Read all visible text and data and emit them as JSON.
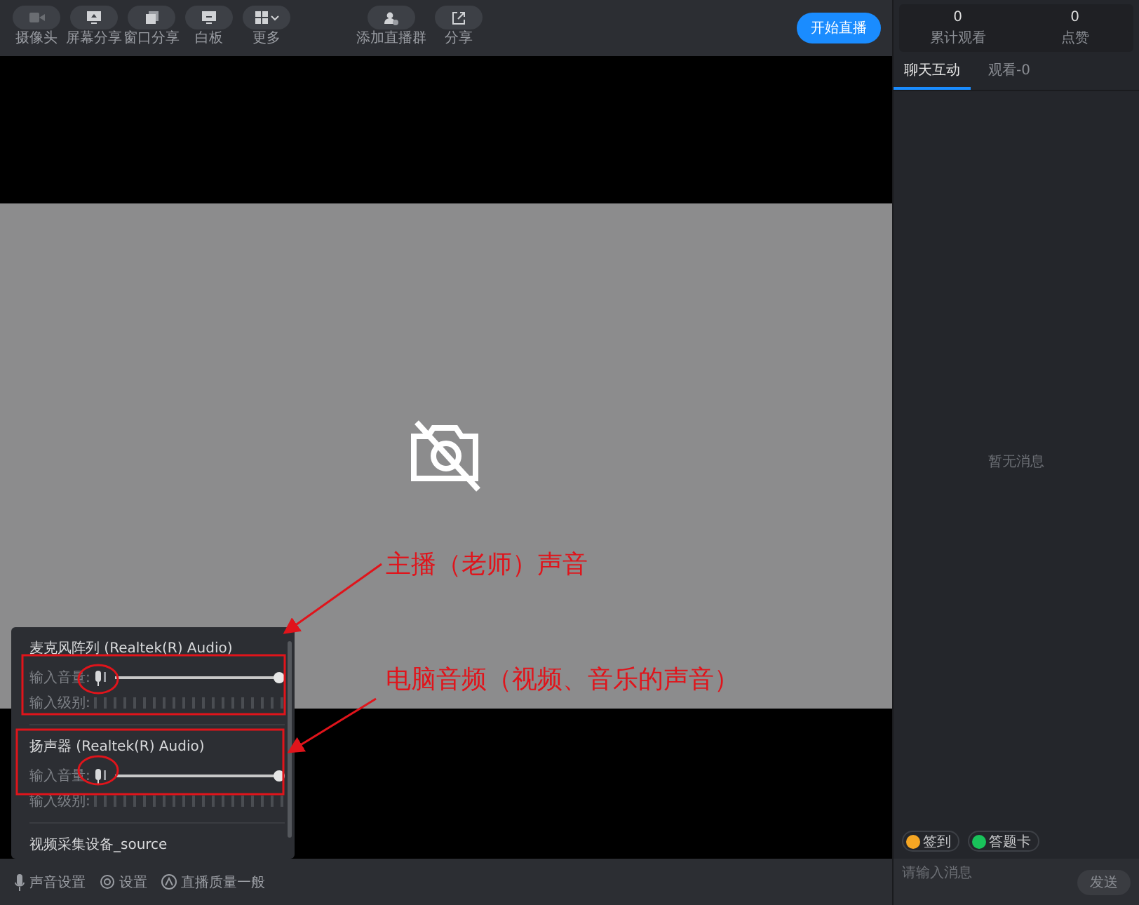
{
  "toolbar": {
    "tools": [
      {
        "kind": "camera",
        "label": "摄像头"
      },
      {
        "kind": "screen",
        "label": "屏幕分享"
      },
      {
        "kind": "window",
        "label": "窗口分享"
      },
      {
        "kind": "whiteboard",
        "label": "白板"
      },
      {
        "kind": "more",
        "label": "更多"
      }
    ],
    "group_tools": [
      {
        "kind": "group",
        "label": "添加直播群"
      },
      {
        "kind": "share",
        "label": "分享"
      }
    ],
    "start_button": "开始直播"
  },
  "audio_popup": {
    "devices": [
      {
        "name": "麦克风阵列 (Realtek(R) Audio)",
        "volume_label": "输入音量:",
        "level": 1,
        "meter_label": "输入级别:"
      },
      {
        "name": "扬声器 (Realtek(R) Audio)",
        "volume_label": "输入音量:",
        "level": 1,
        "meter_label": "输入级别:"
      },
      {
        "name": "视频采集设备_source"
      }
    ]
  },
  "annotations": [
    {
      "text": "主播（老师）声音"
    },
    {
      "text": "电脑音频（视频、音乐的声音）"
    }
  ],
  "bottom_bar": [
    {
      "kind": "mic",
      "label": "声音设置"
    },
    {
      "kind": "gear",
      "label": "设置"
    },
    {
      "kind": "quality",
      "label": "直播质量一般"
    }
  ],
  "stats": [
    {
      "value": "0",
      "label": "累计观看"
    },
    {
      "value": "0",
      "label": "点赞"
    }
  ],
  "tabs": [
    {
      "label": "聊天互动",
      "selected": true
    },
    {
      "label": "观看-0",
      "selected": false
    }
  ],
  "chat": {
    "empty_text": "暂无消息",
    "actions": [
      {
        "label": "签到",
        "color": "#f5a623"
      },
      {
        "label": "答题卡",
        "color": "#19c25a"
      }
    ],
    "placeholder": "请输入消息",
    "send": "发送"
  }
}
